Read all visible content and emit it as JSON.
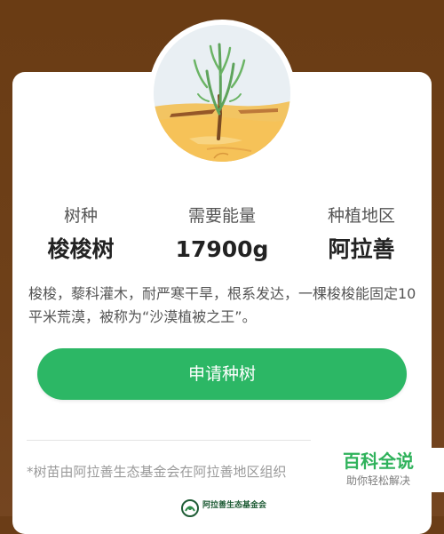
{
  "tree": {
    "illustration_icon": "saxaul-tree-illustration"
  },
  "stats": [
    {
      "label": "树种",
      "value": "梭梭树"
    },
    {
      "label": "需要能量",
      "value": "17900g"
    },
    {
      "label": "种植地区",
      "value": "阿拉善"
    }
  ],
  "description": "梭梭，藜科灌木，耐严寒干旱，根系发达，一棵梭梭能固定10平米荒漠，被称为“沙漠植被之王”。",
  "actions": {
    "plant_label": "申请种树"
  },
  "footer": {
    "note": "*树苗由阿拉善生态基金会在阿拉善地区组织",
    "logo_icon": "foundation-logo-icon",
    "logo_text": "阿拉善生态基金会"
  },
  "watermark": {
    "title": "百科全说",
    "subtitle": "助你轻松解决"
  },
  "colors": {
    "background": "#6b3d17",
    "accent": "#2cb765",
    "watermark": "#2fb25b"
  }
}
